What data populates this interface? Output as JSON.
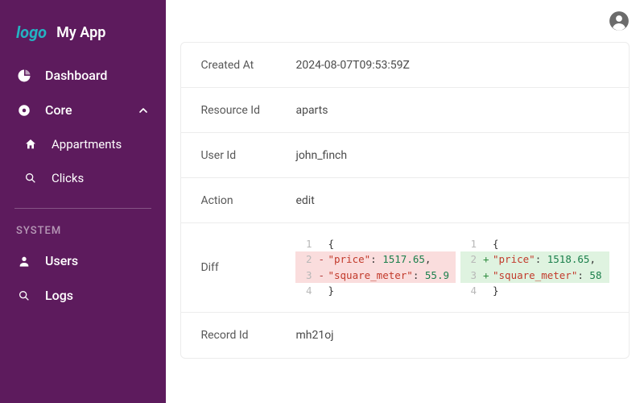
{
  "brand": {
    "logo_text": "logo",
    "title": "My App"
  },
  "sidebar": {
    "items": [
      {
        "icon": "pie",
        "label": "Dashboard"
      },
      {
        "icon": "core",
        "label": "Core",
        "expandable": true,
        "expanded": true
      }
    ],
    "core_children": [
      {
        "icon": "home",
        "label": "Appartments"
      },
      {
        "icon": "search",
        "label": "Clicks"
      }
    ],
    "system_label": "SYSTEM",
    "system_items": [
      {
        "icon": "user",
        "label": "Users"
      },
      {
        "icon": "search",
        "label": "Logs"
      }
    ]
  },
  "detail": {
    "rows": {
      "created_at": {
        "label": "Created At",
        "value": "2024-08-07T09:53:59Z"
      },
      "resource_id": {
        "label": "Resource Id",
        "value": "aparts"
      },
      "user_id": {
        "label": "User Id",
        "value": "john_finch"
      },
      "action": {
        "label": "Action",
        "value": "edit"
      },
      "diff": {
        "label": "Diff"
      },
      "record_id": {
        "label": "Record Id",
        "value": "mh21oj"
      }
    }
  },
  "diff": {
    "before": [
      {
        "n": 1,
        "mark": "",
        "tokens": [
          {
            "t": "{",
            "c": ""
          }
        ]
      },
      {
        "n": 2,
        "mark": "-",
        "tokens": [
          {
            "t": "\"price\"",
            "c": "key"
          },
          {
            "t": ": ",
            "c": ""
          },
          {
            "t": "1517.65",
            "c": "num"
          },
          {
            "t": ",",
            "c": ""
          }
        ]
      },
      {
        "n": 3,
        "mark": "-",
        "tokens": [
          {
            "t": "\"square_meter\"",
            "c": "key"
          },
          {
            "t": ": ",
            "c": ""
          },
          {
            "t": "55.9",
            "c": "num"
          }
        ]
      },
      {
        "n": 4,
        "mark": "",
        "tokens": [
          {
            "t": "}",
            "c": ""
          }
        ]
      }
    ],
    "after": [
      {
        "n": 1,
        "mark": "",
        "tokens": [
          {
            "t": "{",
            "c": ""
          }
        ]
      },
      {
        "n": 2,
        "mark": "+",
        "tokens": [
          {
            "t": "\"price\"",
            "c": "key"
          },
          {
            "t": ": ",
            "c": ""
          },
          {
            "t": "1518.65",
            "c": "num"
          },
          {
            "t": ",",
            "c": ""
          }
        ]
      },
      {
        "n": 3,
        "mark": "+",
        "tokens": [
          {
            "t": "\"square_meter\"",
            "c": "key"
          },
          {
            "t": ": ",
            "c": ""
          },
          {
            "t": "58",
            "c": "num"
          }
        ]
      },
      {
        "n": 4,
        "mark": "",
        "tokens": [
          {
            "t": "}",
            "c": ""
          }
        ]
      }
    ]
  }
}
